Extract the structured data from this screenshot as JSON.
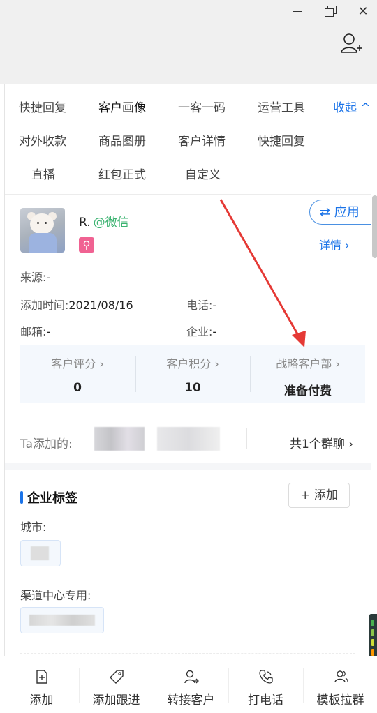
{
  "window": {
    "minimize_icon": "minimize-icon",
    "maximize_icon": "restore-icon",
    "close_icon": "close-icon",
    "close_glyph": "✕",
    "add_contact_icon": "add-contact-icon"
  },
  "tabs": [
    {
      "label": "快捷回复"
    },
    {
      "label": "客户画像",
      "active": true
    },
    {
      "label": "一客一码"
    },
    {
      "label": "运营工具"
    },
    {
      "label": "收起 ^"
    },
    {
      "label": "对外收款"
    },
    {
      "label": "商品图册"
    },
    {
      "label": "客户详情"
    },
    {
      "label": "快捷回复"
    },
    {
      "label": "直播"
    },
    {
      "label": "红包正式"
    },
    {
      "label": "自定义"
    }
  ],
  "profile": {
    "name": "R.",
    "source_tag": "@微信",
    "gender_symbol": "♀",
    "apply_label": "⇄ 应用",
    "detail_label": "详情 ›",
    "source": {
      "label": "来源:",
      "value": "-"
    },
    "added_time": {
      "label": "添加时间:",
      "value": "2021/08/16"
    },
    "phone": {
      "label": "电话:",
      "value": "-"
    },
    "email": {
      "label": "邮箱:",
      "value": "-"
    },
    "company": {
      "label": "企业:",
      "value": "-"
    }
  },
  "stats": [
    {
      "label": "客户评分 ›",
      "value": "0"
    },
    {
      "label": "客户积分 ›",
      "value": "10"
    },
    {
      "label": "战略客户部 ›",
      "value": "准备付费"
    }
  ],
  "ta_added": {
    "label": "Ta添加的:",
    "group_link": "共1个群聊 ›"
  },
  "enterprise_tags": {
    "title": "企业标签",
    "add_label": "+ 添加",
    "city_label": "城市:",
    "channel_label": "渠道中心专用:"
  },
  "bottom_actions": [
    {
      "label": "添加",
      "icon": "add-file-icon"
    },
    {
      "label": "添加跟进",
      "icon": "tag-icon"
    },
    {
      "label": "转接客户",
      "icon": "transfer-user-icon"
    },
    {
      "label": "打电话",
      "icon": "phone-icon"
    },
    {
      "label": "模板拉群",
      "icon": "group-icon"
    }
  ],
  "colors": {
    "accent": "#1a73e8",
    "wechat_green": "#3cb371",
    "female_pink": "#f06292",
    "annotation_red": "#e53935"
  }
}
